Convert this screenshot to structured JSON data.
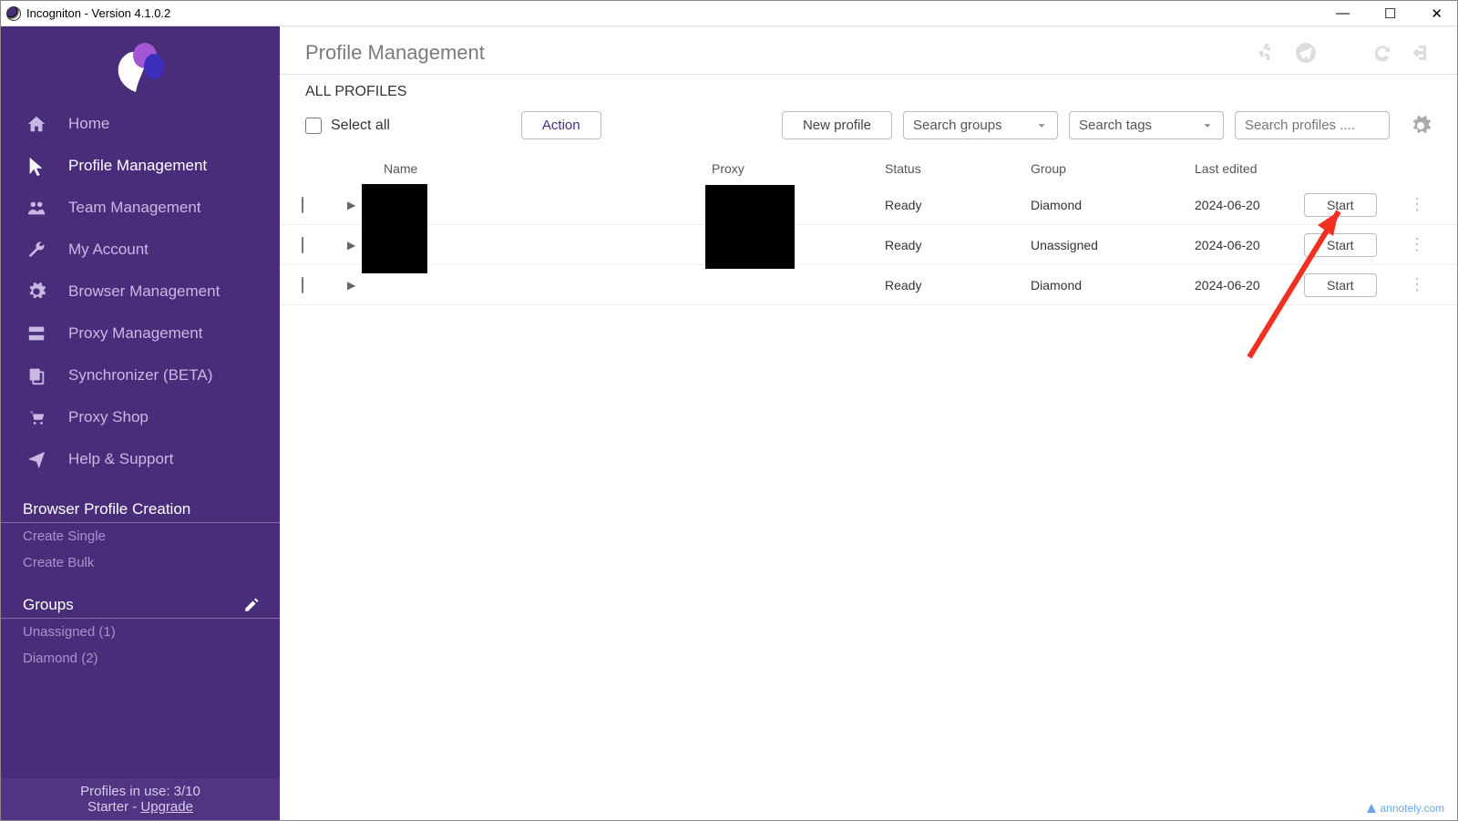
{
  "window": {
    "title": "Incogniton - Version 4.1.0.2"
  },
  "sidebar": {
    "nav": [
      {
        "label": "Home"
      },
      {
        "label": "Profile Management"
      },
      {
        "label": "Team Management"
      },
      {
        "label": "My Account"
      },
      {
        "label": "Browser Management"
      },
      {
        "label": "Proxy Management"
      },
      {
        "label": "Synchronizer (BETA)"
      },
      {
        "label": "Proxy Shop"
      },
      {
        "label": "Help & Support"
      }
    ],
    "creation_header": "Browser Profile Creation",
    "create_single": "Create Single",
    "create_bulk": "Create Bulk",
    "groups_header": "Groups",
    "groups": [
      {
        "label": "Unassigned (1)"
      },
      {
        "label": "Diamond (2)"
      }
    ],
    "footer_line1": "Profiles in use:  3/10",
    "footer_line2_prefix": "Starter - ",
    "footer_upgrade": "Upgrade"
  },
  "content": {
    "title": "Profile Management",
    "subtitle": "ALL PROFILES",
    "select_all": "Select all",
    "action_btn": "Action",
    "new_profile": "New profile",
    "search_groups": "Search groups",
    "search_tags": "Search tags",
    "search_profiles_ph": "Search profiles ....",
    "columns": {
      "name": "Name",
      "proxy": "Proxy",
      "status": "Status",
      "group": "Group",
      "last_edited": "Last edited"
    },
    "rows": [
      {
        "status": "Ready",
        "group": "Diamond",
        "last_edited": "2024-06-20",
        "start": "Start"
      },
      {
        "status": "Ready",
        "group": "Unassigned",
        "last_edited": "2024-06-20",
        "start": "Start"
      },
      {
        "status": "Ready",
        "group": "Diamond",
        "last_edited": "2024-06-20",
        "start": "Start"
      }
    ]
  },
  "annotely": "annotely.com"
}
